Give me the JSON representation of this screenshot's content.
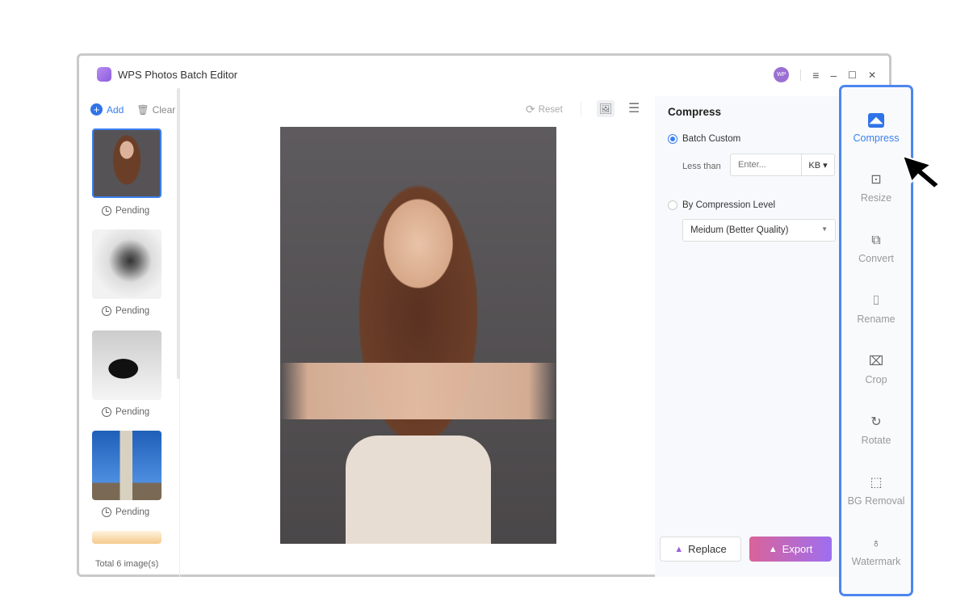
{
  "window": {
    "title": "WPS Photos Batch Editor",
    "avatar": "WP",
    "menu_icon": "≡",
    "min_icon": "–",
    "max_icon": "☐",
    "close_icon": "✕"
  },
  "left": {
    "add": "Add",
    "clear": "Clear",
    "items": [
      {
        "status": "Pending"
      },
      {
        "status": "Pending"
      },
      {
        "status": "Pending"
      },
      {
        "status": "Pending"
      }
    ],
    "total": "Total 6 image(s)"
  },
  "toolbar": {
    "reset": "Reset"
  },
  "panel": {
    "title": "Compress",
    "batch_custom": "Batch Custom",
    "less_than": "Less than",
    "input_placeholder": "Enter...",
    "unit": "KB ▾",
    "by_level": "By Compression Level",
    "level_value": "Meidum (Better Quality)",
    "replace": "Replace",
    "export": "Export"
  },
  "sidebar": [
    {
      "label": "Compress",
      "icon": "compress-icon",
      "glyph": "▣"
    },
    {
      "label": "Resize",
      "icon": "resize-icon",
      "glyph": "⊡"
    },
    {
      "label": "Convert",
      "icon": "convert-icon",
      "glyph": "⧉"
    },
    {
      "label": "Rename",
      "icon": "rename-icon",
      "glyph": "⌷"
    },
    {
      "label": "Crop",
      "icon": "crop-icon",
      "glyph": "⌧"
    },
    {
      "label": "Rotate",
      "icon": "rotate-icon",
      "glyph": "↻"
    },
    {
      "label": "BG Removal",
      "icon": "bg-removal-icon",
      "glyph": "⬚"
    },
    {
      "label": "Watermark",
      "icon": "watermark-icon",
      "glyph": "♁"
    }
  ],
  "colors": {
    "accent": "#3a7ff0",
    "highlight_border": "#4c86f0"
  }
}
